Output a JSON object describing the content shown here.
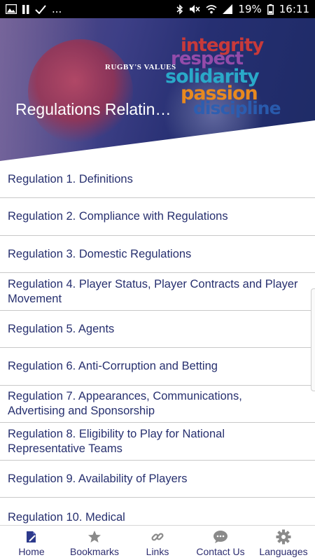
{
  "status_bar": {
    "left_extra": "...",
    "battery_percent": "19%",
    "time": "16:11"
  },
  "banner": {
    "values_caption": "RUGBY'S VALUES",
    "values_words": [
      "integrity",
      "respect",
      "solidarity",
      "passion",
      "discipline"
    ],
    "title": "Regulations Relatin…"
  },
  "list": {
    "items": [
      "Regulation 1. Definitions",
      "Regulation 2. Compliance with Regulations",
      "Regulation 3. Domestic Regulations",
      "Regulation 4. Player Status, Player Contracts and Player Movement",
      "Regulation 5. Agents",
      "Regulation 6. Anti-Corruption and Betting",
      "Regulation 7. Appearances, Communications, Advertising and Sponsorship",
      "Regulation 8. Eligibility to Play for National Representative Teams",
      "Regulation 9. Availability of Players",
      "Regulation 10. Medical"
    ]
  },
  "bottom_nav": {
    "items": [
      {
        "label": "Home",
        "icon": "home-book-icon"
      },
      {
        "label": "Bookmarks",
        "icon": "star-icon"
      },
      {
        "label": "Links",
        "icon": "link-icon"
      },
      {
        "label": "Contact Us",
        "icon": "chat-bubble-icon"
      },
      {
        "label": "Languages",
        "icon": "gear-icon"
      }
    ]
  },
  "colors": {
    "text": "#27306f",
    "nav_label": "#2d2d70",
    "icon": "#8a8a8a",
    "home_icon": "#2d3a8c"
  }
}
